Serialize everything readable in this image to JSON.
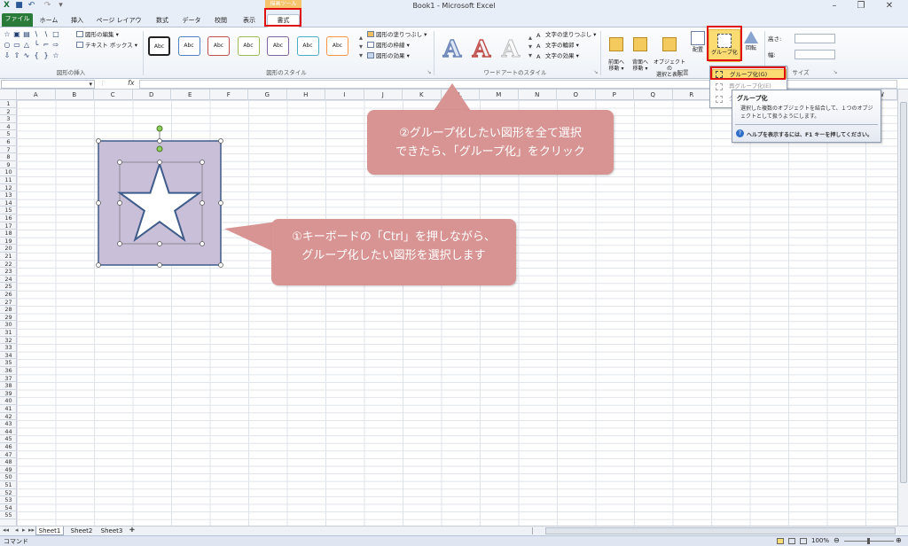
{
  "window": {
    "title": "Book1 - Microsoft Excel"
  },
  "contextual_tab": {
    "label": "描画ツール"
  },
  "tabs": [
    "ファイル",
    "ホーム",
    "挿入",
    "ページ レイアウト",
    "数式",
    "データ",
    "校閲",
    "表示",
    "書式"
  ],
  "ribbon": {
    "insert_shapes": {
      "edit_shape": "図形の編集",
      "text_box": "テキスト ボックス",
      "label": "図形の挿入"
    },
    "shape_styles": {
      "sample": "Abc",
      "fill": "図形の塗りつぶし",
      "outline": "図形の枠線",
      "effects": "図形の効果",
      "label": "図形のスタイル",
      "outline_colors": [
        "#222222",
        "#4f81bd",
        "#c0504d",
        "#9bbb59",
        "#8064a2",
        "#4bacc6",
        "#f79646"
      ]
    },
    "wordart": {
      "letter": "A",
      "text_fill": "文字の塗りつぶし",
      "text_outline": "文字の輪郭",
      "text_effects": "文字の効果",
      "label": "ワードアートのスタイル"
    },
    "arrange": {
      "bring_forward": "前面へ\n移動",
      "send_backward": "背面へ\n移動",
      "selection_pane": "オブジェクトの\n選択と表示",
      "align": "配置",
      "group": "グループ化",
      "rotate": "回転",
      "label": "配置"
    },
    "size": {
      "height_label": "高さ:",
      "width_label": "幅:",
      "label": "サイズ"
    }
  },
  "formula_bar": {
    "fx": "fx"
  },
  "grid": {
    "columns": [
      "A",
      "B",
      "C",
      "D",
      "E",
      "F",
      "G",
      "H",
      "I",
      "J",
      "K",
      "L",
      "M",
      "N",
      "O",
      "P",
      "Q",
      "R",
      "S",
      "T",
      "U",
      "V",
      "W"
    ],
    "rows": [
      "1",
      "2",
      "3",
      "4",
      "5",
      "6",
      "7",
      "8",
      "9",
      "10",
      "11",
      "12",
      "13",
      "14",
      "15",
      "16",
      "17",
      "18",
      "19",
      "20",
      "21",
      "22",
      "23",
      "24",
      "25",
      "26",
      "27",
      "28",
      "29",
      "30",
      "31",
      "32",
      "33",
      "34",
      "35",
      "36",
      "37",
      "38",
      "39",
      "40",
      "41",
      "42",
      "43",
      "44",
      "45",
      "46",
      "47",
      "48",
      "49",
      "50",
      "51",
      "52",
      "53",
      "54",
      "55"
    ]
  },
  "dropdown": {
    "items": [
      "グループ化(G)",
      "再グループ化(E)",
      "グループ解除(U)"
    ]
  },
  "tooltip": {
    "title": "グループ化",
    "body": "選択した複数のオブジェクトを結合して、１つのオブジェクトとして扱うようにします。",
    "help": "ヘルプを表示するには、F1 キーを押してください。"
  },
  "callouts": {
    "step2_line1": "②グループ化したい図形を全て選択",
    "step2_line2": "できたら、「グループ化」をクリック",
    "step1_line1": "①キーボードの「Ctrl」を押しながら、",
    "step1_line2": "グループ化したい図形を選択します"
  },
  "sheets": [
    "Sheet1",
    "Sheet2",
    "Sheet3"
  ],
  "status": {
    "mode": "コマンド",
    "zoom": "100%"
  },
  "colors": {
    "accent_red": "#e01010",
    "callout": "#d89393",
    "file_tab": "#2a7a3a",
    "shape_fill": "#c9bfd9",
    "shape_stroke": "#3f5b8a"
  }
}
